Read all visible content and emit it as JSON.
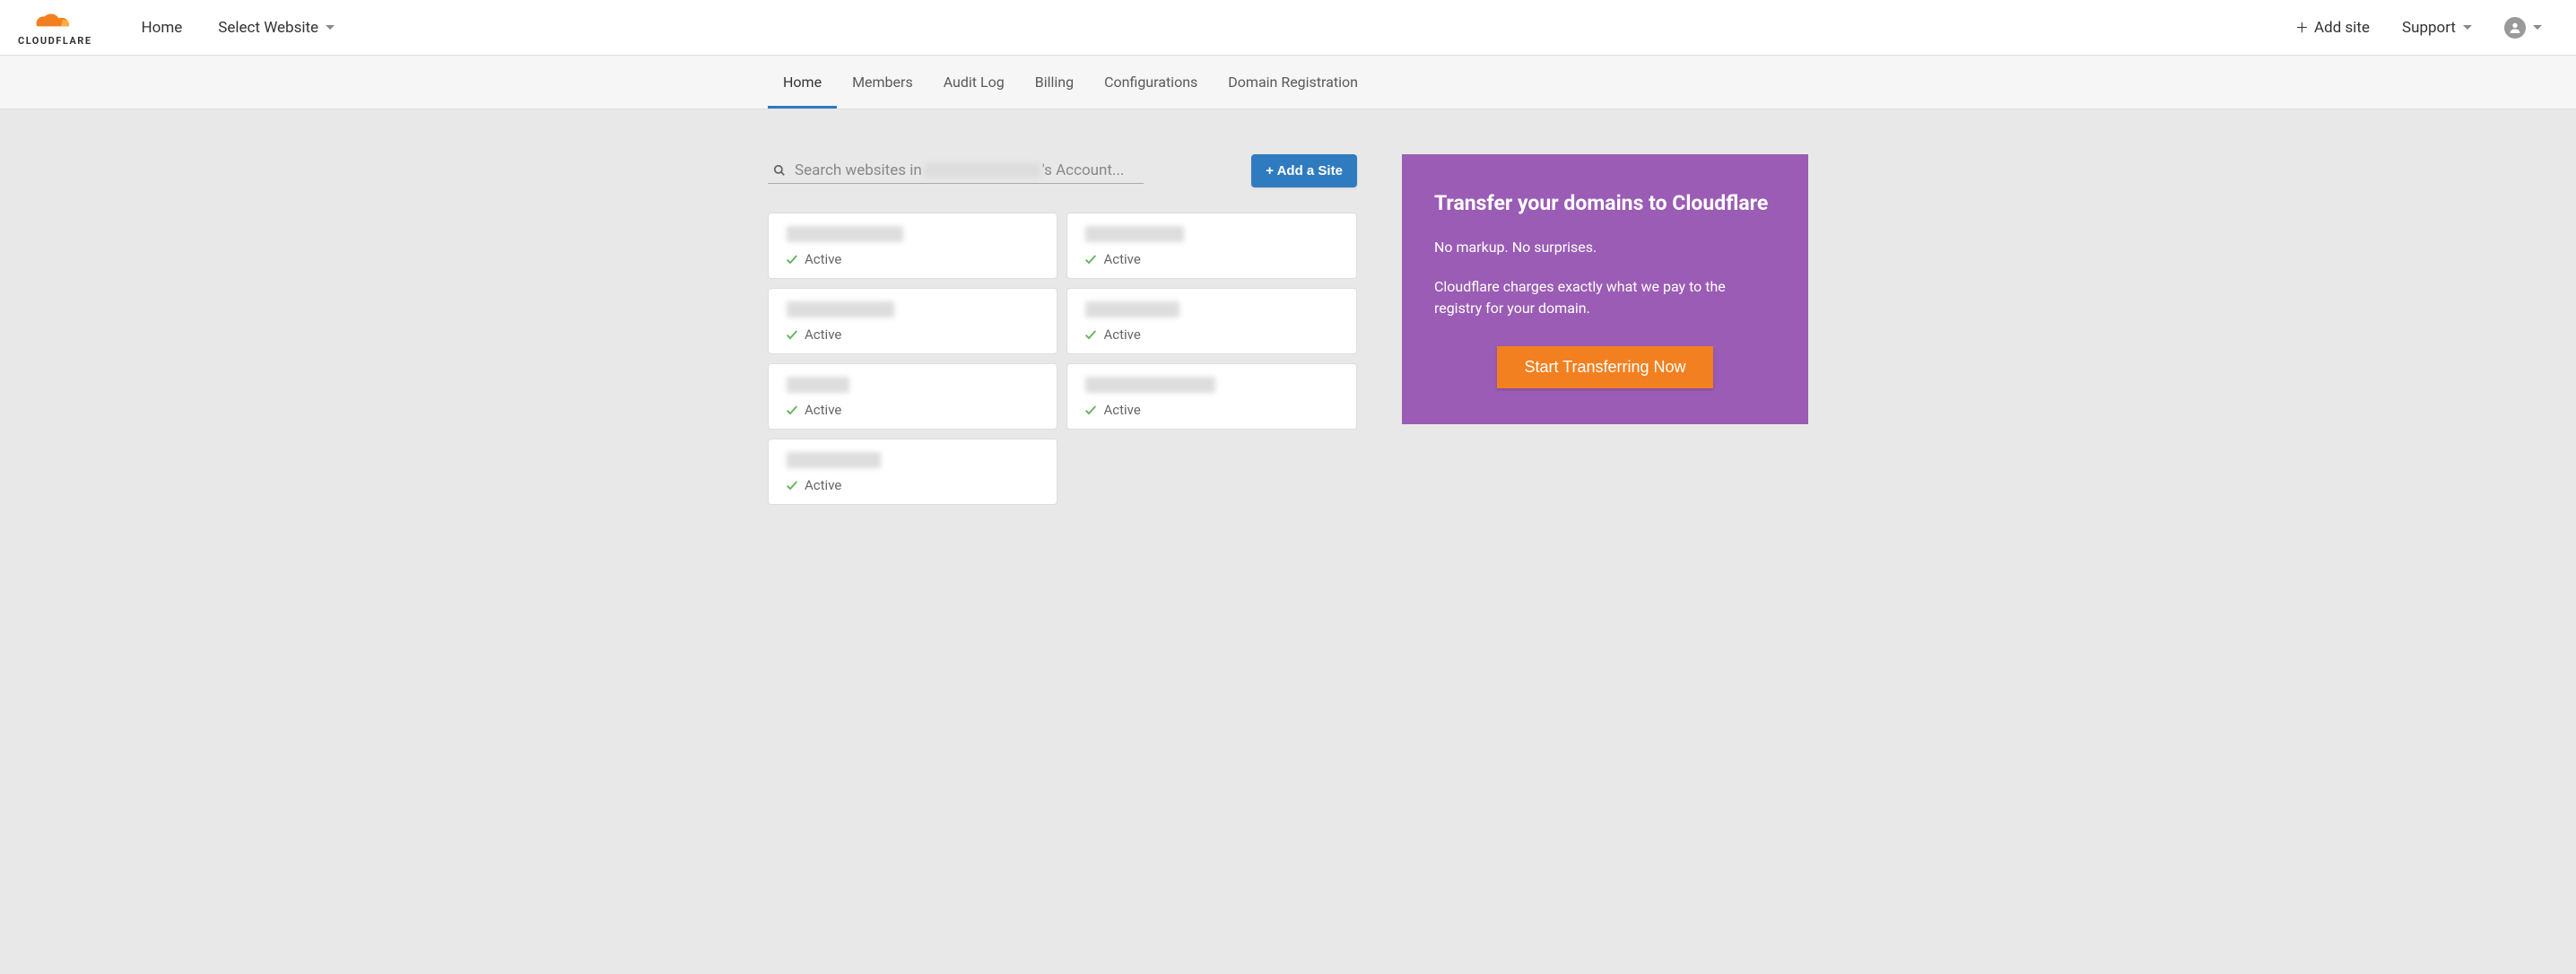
{
  "brand": "CLOUDFLARE",
  "topnav": {
    "home": "Home",
    "select_website": "Select Website",
    "add_site": "Add site",
    "support": "Support"
  },
  "subnav": {
    "items": [
      {
        "label": "Home",
        "active": true
      },
      {
        "label": "Members",
        "active": false
      },
      {
        "label": "Audit Log",
        "active": false
      },
      {
        "label": "Billing",
        "active": false
      },
      {
        "label": "Configurations",
        "active": false
      },
      {
        "label": "Domain Registration",
        "active": false
      }
    ]
  },
  "search": {
    "prefix": "Search websites in ",
    "suffix": "'s Account..."
  },
  "add_site_button": "+ Add a Site",
  "sites": [
    {
      "status": "Active"
    },
    {
      "status": "Active"
    },
    {
      "status": "Active"
    },
    {
      "status": "Active"
    },
    {
      "status": "Active"
    },
    {
      "status": "Active"
    },
    {
      "status": "Active"
    }
  ],
  "promo": {
    "title": "Transfer your domains to Cloudflare",
    "line1": "No markup. No surprises.",
    "line2": "Cloudflare charges exactly what we pay to the registry for your domain.",
    "cta": "Start Transferring Now"
  },
  "colors": {
    "accent_blue": "#2f7bbf",
    "brand_orange": "#f38020",
    "promo_purple": "#9a5cb4",
    "check_green": "#68b760"
  }
}
